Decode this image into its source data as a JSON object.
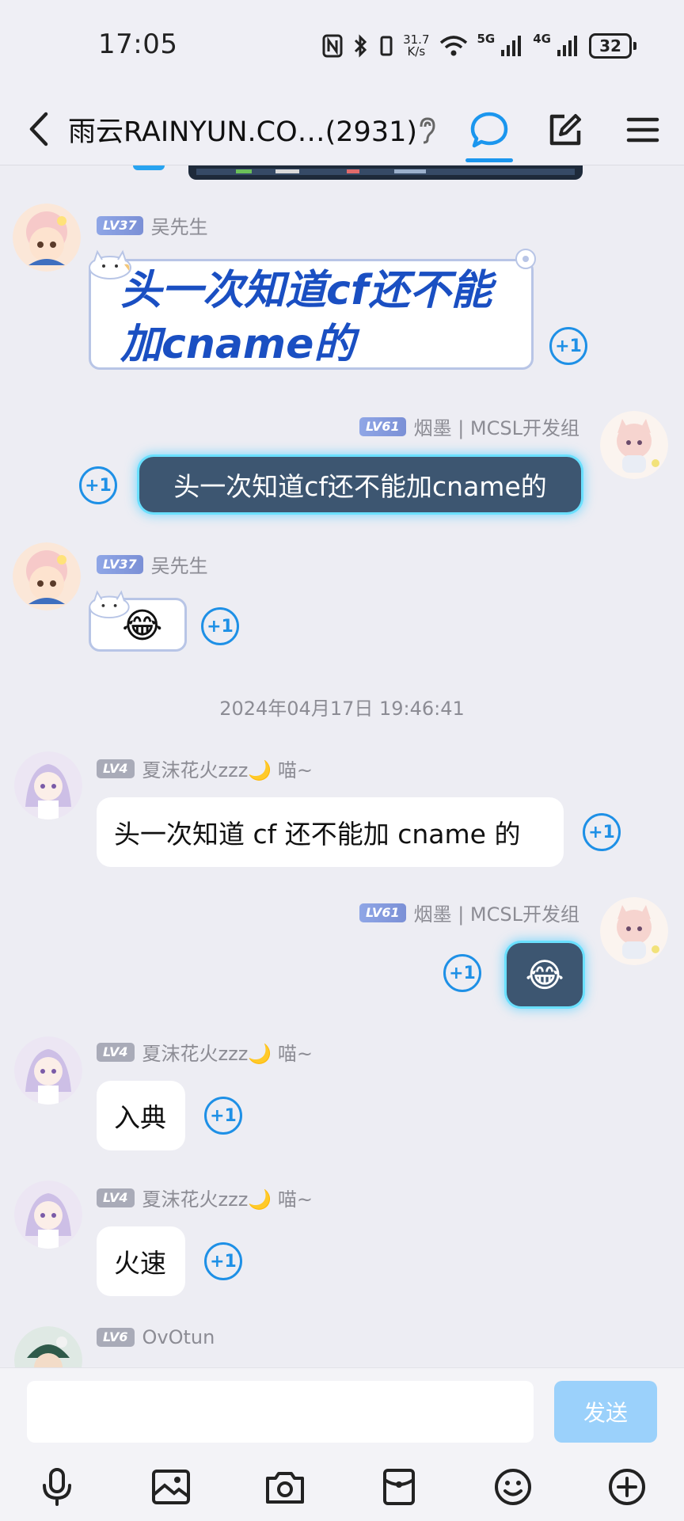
{
  "status_bar": {
    "time": "17:05",
    "net_speed_value": "31.7",
    "net_speed_unit": "K/s",
    "signal1_tag": "5G",
    "signal2_tag": "4G",
    "battery": "32"
  },
  "header": {
    "title": "雨云RAINYUN.CO…(2931)",
    "icons": [
      "back-icon",
      "ear-icon",
      "chat-bubble-icon",
      "edit-icon",
      "menu-icon"
    ]
  },
  "messages": [
    {
      "side": "left",
      "level": "LV37",
      "sender": "吴先生",
      "text": "头一次知道cf还不能加cname的",
      "style": "sticker-large",
      "plus_one": "+1"
    },
    {
      "side": "right",
      "level": "LV61",
      "sender": "烟墨 | MCSL开发组",
      "text": "头一次知道cf还不能加cname的",
      "style": "dark-bubble",
      "plus_one": "+1"
    },
    {
      "side": "left",
      "level": "LV37",
      "sender": "吴先生",
      "text": "😂",
      "style": "sticker-small",
      "plus_one": "+1"
    },
    {
      "side": "right",
      "level": "LV61",
      "sender": "烟墨 | MCSL开发组",
      "text": "😂",
      "style": "dark-bubble",
      "plus_one": "+1"
    },
    {
      "side": "left",
      "level": "LV4",
      "sender": "夏沫花火zzz🌙 喵~",
      "text": "头一次知道 cf 还不能加 cname 的",
      "style": "white-bubble",
      "plus_one": "+1"
    },
    {
      "side": "left",
      "level": "LV4",
      "sender": "夏沫花火zzz🌙 喵~",
      "text": "入典",
      "style": "white-bubble",
      "plus_one": "+1"
    },
    {
      "side": "left",
      "level": "LV4",
      "sender": "夏沫花火zzz🌙 喵~",
      "text": "火速",
      "style": "white-bubble",
      "plus_one": "+1"
    },
    {
      "side": "left",
      "level": "LV6",
      "sender": "OvOtun",
      "text": "",
      "style": "partial"
    }
  ],
  "timestamp": "2024年04月17日 19:46:41",
  "input": {
    "value": "",
    "placeholder": "",
    "send_label": "发送"
  },
  "toolbar_icons": [
    "microphone-icon",
    "image-icon",
    "camera-icon",
    "red-packet-icon",
    "emoji-icon",
    "plus-icon"
  ],
  "colors": {
    "accent": "#1e90e6",
    "send_disabled": "#9bd1fb",
    "dark_bubble": "#3d5671",
    "glow": "#6ae0ff",
    "sticker_text": "#1a4fc2"
  }
}
